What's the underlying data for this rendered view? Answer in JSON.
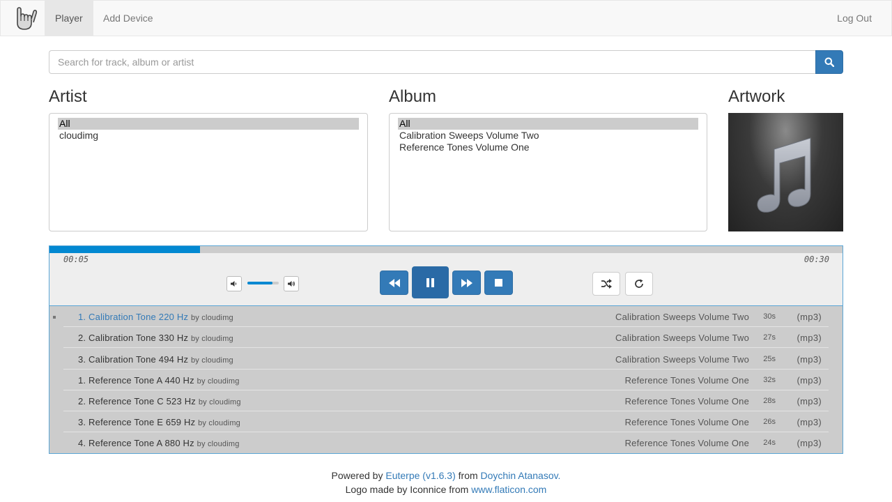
{
  "nav": {
    "logo_icon": "rock-hand-icon",
    "items": [
      {
        "label": "Player",
        "active": true
      },
      {
        "label": "Add Device",
        "active": false
      }
    ],
    "logout_label": "Log Out"
  },
  "search": {
    "placeholder": "Search for track, album or artist",
    "value": "",
    "button_icon": "search-icon"
  },
  "artist": {
    "title": "Artist",
    "options": [
      {
        "label": "All",
        "selected": true
      },
      {
        "label": "cloudimg",
        "selected": false
      }
    ]
  },
  "album": {
    "title": "Album",
    "options": [
      {
        "label": "All",
        "selected": true
      },
      {
        "label": "Calibration Sweeps Volume Two",
        "selected": false
      },
      {
        "label": "Reference Tones Volume One",
        "selected": false
      }
    ]
  },
  "artwork": {
    "title": "Artwork",
    "icon": "music-note-icon"
  },
  "player": {
    "current_time": "00:05",
    "total_time": "00:30",
    "progress_fraction": 0.19,
    "volume_fraction": 0.8,
    "accent_color": "#0288d1",
    "button_color": "#337ab7"
  },
  "playlist": [
    {
      "title": "1. Calibration Tone 220 Hz",
      "by": "by cloudimg",
      "album": "Calibration Sweeps Volume Two",
      "duration": "30s",
      "format": "(mp3)",
      "playing": true
    },
    {
      "title": "2. Calibration Tone 330 Hz",
      "by": "by cloudimg",
      "album": "Calibration Sweeps Volume Two",
      "duration": "27s",
      "format": "(mp3)",
      "playing": false
    },
    {
      "title": "3. Calibration Tone 494 Hz",
      "by": "by cloudimg",
      "album": "Calibration Sweeps Volume Two",
      "duration": "25s",
      "format": "(mp3)",
      "playing": false
    },
    {
      "title": "1. Reference Tone A 440 Hz",
      "by": "by cloudimg",
      "album": "Reference Tones Volume One",
      "duration": "32s",
      "format": "(mp3)",
      "playing": false
    },
    {
      "title": "2. Reference Tone C 523 Hz",
      "by": "by cloudimg",
      "album": "Reference Tones Volume One",
      "duration": "28s",
      "format": "(mp3)",
      "playing": false
    },
    {
      "title": "3. Reference Tone E 659 Hz",
      "by": "by cloudimg",
      "album": "Reference Tones Volume One",
      "duration": "26s",
      "format": "(mp3)",
      "playing": false
    },
    {
      "title": "4. Reference Tone A 880 Hz",
      "by": "by cloudimg",
      "album": "Reference Tones Volume One",
      "duration": "24s",
      "format": "(mp3)",
      "playing": false
    }
  ],
  "footer": {
    "powered_prefix": "Powered by",
    "app_link": "Euterpe (v1.6.3)",
    "from_word": "from",
    "author_link": "Doychin Atanasov.",
    "logo_prefix": "Logo made by Iconnice from",
    "logo_link": "www.flaticon.com"
  }
}
